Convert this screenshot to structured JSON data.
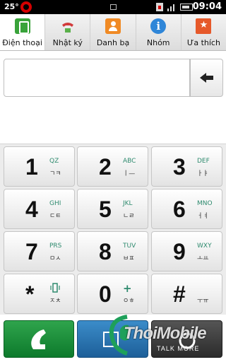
{
  "status_bar": {
    "temperature": "25°",
    "time": "09:04",
    "icons": [
      "beats-icon",
      "sim-icon",
      "signal-icon",
      "battery-icon"
    ]
  },
  "tabs": [
    {
      "label": "Điện thoại",
      "icon": "phone-icon",
      "active": true
    },
    {
      "label": "Nhật ký",
      "icon": "call-log-icon",
      "active": false
    },
    {
      "label": "Danh bạ",
      "icon": "contacts-icon",
      "active": false
    },
    {
      "label": "Nhóm",
      "icon": "groups-icon",
      "active": false
    },
    {
      "label": "Ưa thích",
      "icon": "favorites-icon",
      "active": false
    }
  ],
  "number_field": {
    "value": ""
  },
  "keypad": [
    {
      "digit": "1",
      "letters": "QZ",
      "sub": "ㄱㅋ"
    },
    {
      "digit": "2",
      "letters": "ABC",
      "sub": "ㅣ—"
    },
    {
      "digit": "3",
      "letters": "DEF",
      "sub": "ㅏㅑ"
    },
    {
      "digit": "4",
      "letters": "GHI",
      "sub": "ㄷㅌ"
    },
    {
      "digit": "5",
      "letters": "JKL",
      "sub": "ㄴㄹ"
    },
    {
      "digit": "6",
      "letters": "MNO",
      "sub": "ㅓㅕ"
    },
    {
      "digit": "7",
      "letters": "PRS",
      "sub": "ㅁㅅ"
    },
    {
      "digit": "8",
      "letters": "TUV",
      "sub": "ㅂㅍ"
    },
    {
      "digit": "9",
      "letters": "WXY",
      "sub": "ㅗㅛ"
    },
    {
      "digit": "*",
      "letters": "",
      "sub": "ㅈㅊ"
    },
    {
      "digit": "0",
      "letters": "+",
      "sub": "ㅇㅎ"
    },
    {
      "digit": "#",
      "letters": "",
      "sub": "ㅜㅠ"
    }
  ],
  "watermark": {
    "brand": "ThoiMobile",
    "tagline": "TALK MORE"
  },
  "colors": {
    "call": "#1f9a3f",
    "voicemail": "#2a77b5",
    "more": "#3a3a3a",
    "accent_letters": "#2e8a6e"
  }
}
